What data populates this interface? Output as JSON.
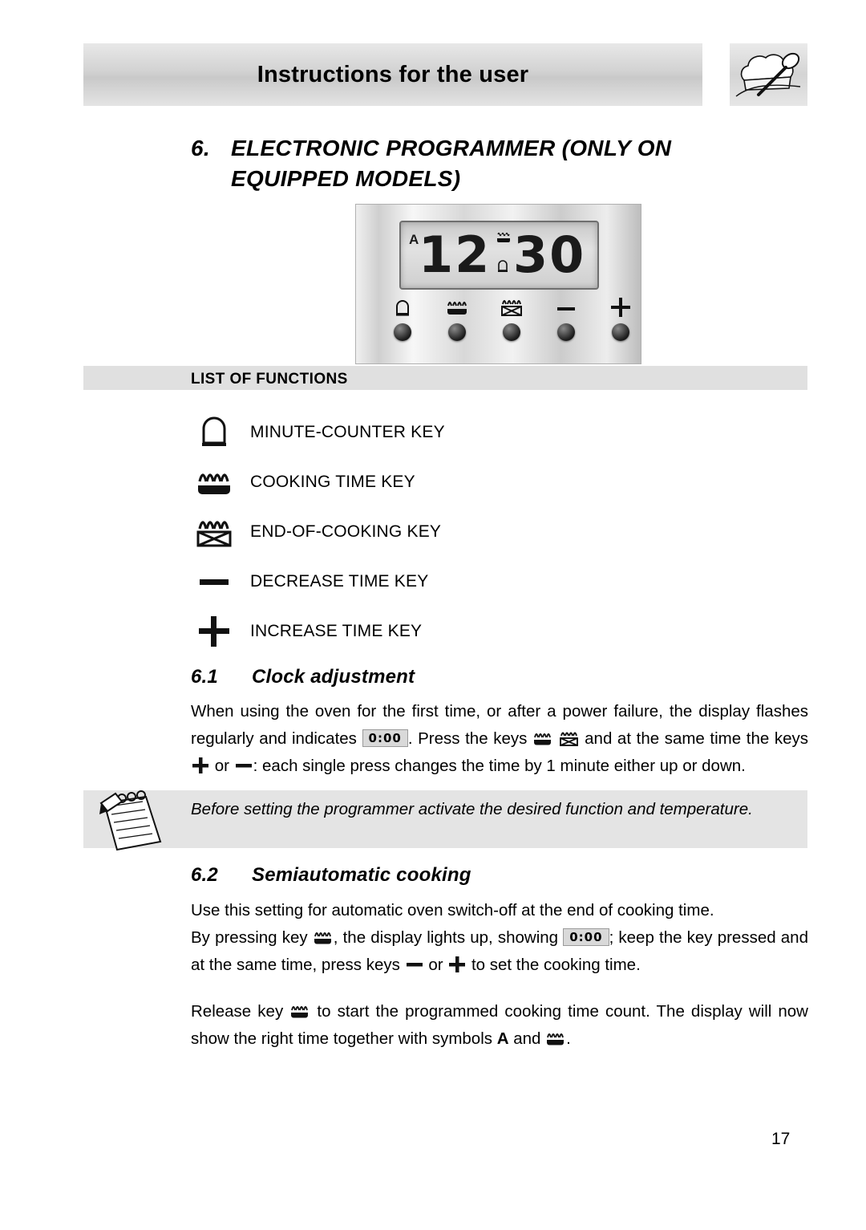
{
  "header": {
    "title": "Instructions for the user",
    "icon": "chef-hat-spoon-icon"
  },
  "section": {
    "number": "6.",
    "title_line1": "ELECTRONIC  PROGRAMMER  (ONLY  ON",
    "title_line2": "EQUIPPED MODELS)"
  },
  "programmer": {
    "display_value": "12 30",
    "display_digits_left": "12",
    "display_digits_right": "30",
    "indicator_a": "A",
    "keys": [
      {
        "name": "minute-counter-key",
        "icon": "bell-icon"
      },
      {
        "name": "cooking-time-key",
        "icon": "pan-heat-icon"
      },
      {
        "name": "end-of-cooking-key",
        "icon": "pan-heat-crossed-icon"
      },
      {
        "name": "decrease-time-key",
        "icon": "minus-icon",
        "label": "−"
      },
      {
        "name": "increase-time-key",
        "icon": "plus-icon",
        "label": "+"
      }
    ]
  },
  "list_of_functions": {
    "heading": "LIST OF FUNCTIONS",
    "items": [
      {
        "icon": "bell-icon",
        "label": "MINUTE-COUNTER KEY"
      },
      {
        "icon": "pan-heat-icon",
        "label": "COOKING TIME KEY"
      },
      {
        "icon": "pan-heat-crossed-icon",
        "label": "END-OF-COOKING KEY"
      },
      {
        "icon": "minus-icon",
        "label": "DECREASE TIME KEY"
      },
      {
        "icon": "plus-icon",
        "label": "INCREASE TIME KEY"
      }
    ]
  },
  "clock_adjustment": {
    "number": "6.1",
    "title": "Clock adjustment",
    "p1_a": "When using the oven for the first time, or after a power failure, the display flashes regularly and indicates",
    "p1_lcd": "0:00",
    "p1_b": ". Press the keys",
    "p1_c": "and at the same time the keys",
    "p1_d": "or",
    "p1_e": ": each single press changes the time by 1 minute either up or down."
  },
  "note": {
    "icon": "notepad-pencil-icon",
    "text": "Before setting the programmer activate the desired function and temperature."
  },
  "semiautomatic_cooking": {
    "number": "6.2",
    "title": "Semiautomatic cooking",
    "p1": "Use this setting for automatic oven switch-off at the end of cooking time.",
    "p2_a": "By pressing key",
    "p2_b": ", the display lights up, showing",
    "p2_lcd": "0:00",
    "p2_c": "; keep the key pressed and at the same time, press keys",
    "p2_d": "or",
    "p2_e": "to set the cooking time.",
    "p3_a": "Release key",
    "p3_b": "to start the programmed cooking time count. The display will now show the right time together with symbols",
    "p3_bold": "A",
    "p3_c": "and",
    "p3_d": "."
  },
  "page_number": "17"
}
